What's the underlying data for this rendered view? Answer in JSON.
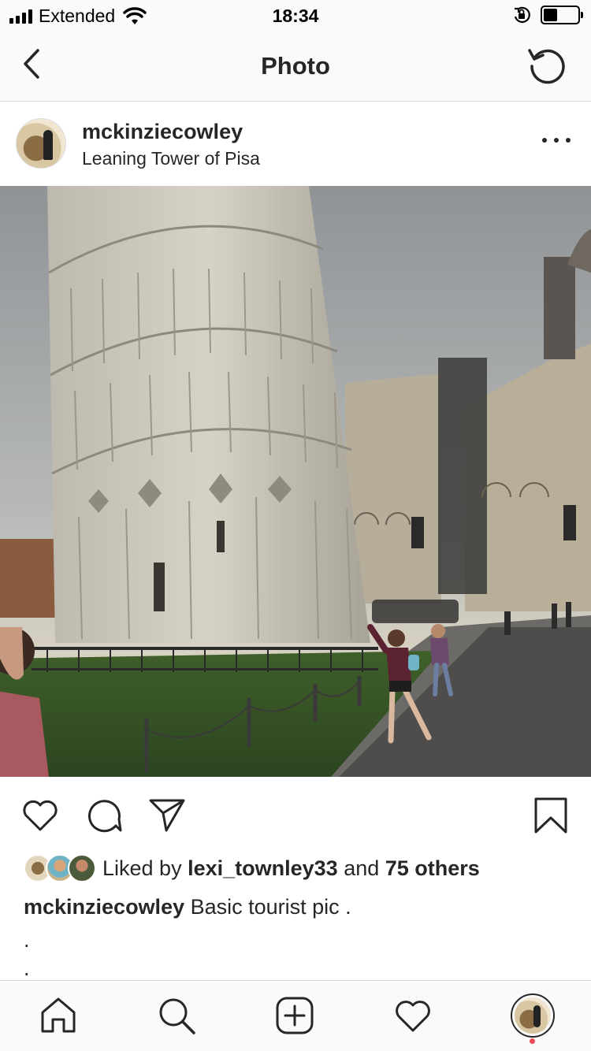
{
  "status_bar": {
    "carrier": "Extended",
    "time": "18:34",
    "battery_level": 0.4,
    "icons": [
      "signal-icon",
      "wifi-icon",
      "rotation-lock-icon",
      "battery-icon"
    ]
  },
  "nav": {
    "title": "Photo",
    "back_icon": "chevron-left-icon",
    "refresh_icon": "refresh-icon"
  },
  "post": {
    "username": "mckinziecowley",
    "location": "Leaning Tower of Pisa",
    "more_icon": "more-horizontal-icon",
    "photo_description_icon": "post-photo"
  },
  "actions": {
    "icons": [
      "heart-icon",
      "comment-icon",
      "share-icon",
      "bookmark-icon"
    ]
  },
  "likes": {
    "prefix": "Liked by ",
    "user": "lexi_townley33",
    "middle": " and ",
    "others": "75 others"
  },
  "caption": {
    "username": "mckinziecowley",
    "text": " Basic tourist pic .",
    "line2": ".",
    "line3": "."
  },
  "tab_bar": {
    "icons": [
      "home-icon",
      "search-icon",
      "add-post-icon",
      "activity-heart-icon",
      "profile-avatar"
    ],
    "notification_color": "#ed4956"
  },
  "colors": {
    "text": "#262626",
    "divider": "#dbdbdb",
    "bar_background": "#fafafa"
  }
}
